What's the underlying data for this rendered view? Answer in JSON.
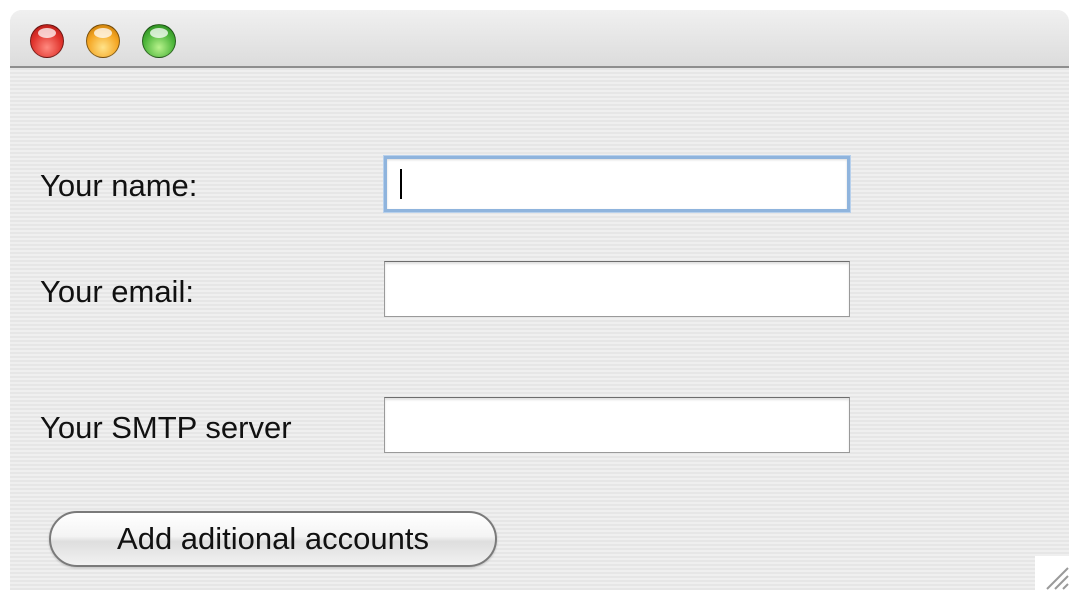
{
  "window": {
    "controls": {
      "close": "close-button",
      "minimize": "minimize-button",
      "zoom": "zoom-button"
    }
  },
  "form": {
    "name_label": "Your name:",
    "name_value": "",
    "email_label": "Your email:",
    "email_value": "",
    "smtp_label": "Your SMTP server",
    "smtp_value": ""
  },
  "actions": {
    "add_accounts_label": "Add aditional accounts"
  },
  "colors": {
    "close": "#e0332c",
    "minimize": "#f5a623",
    "zoom": "#4cb53a",
    "focus_ring": "#8fb4dd"
  }
}
